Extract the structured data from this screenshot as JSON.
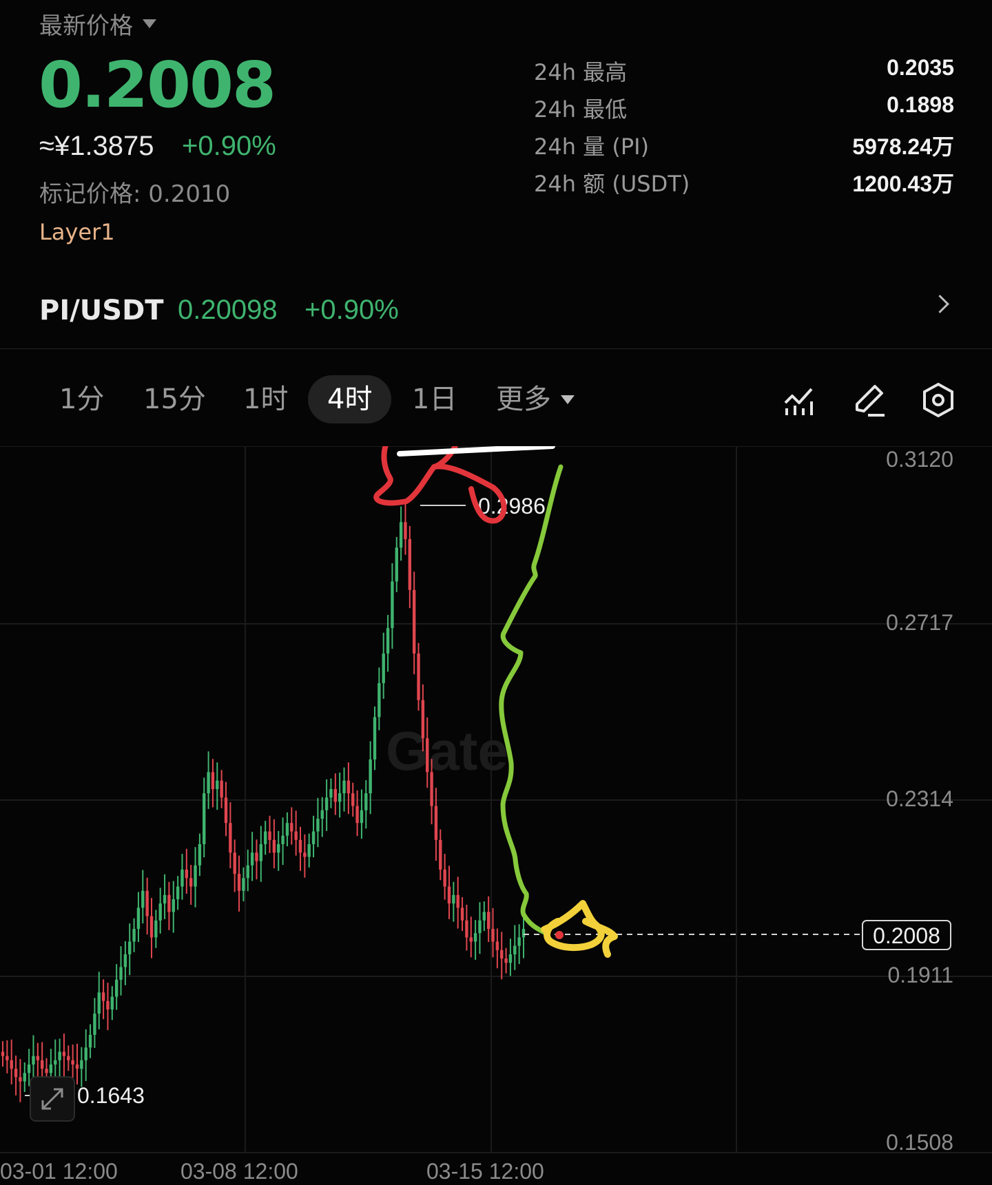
{
  "header": {
    "latest_price_label": "最新价格",
    "last_price": "0.2008",
    "cny_price": "≈¥1.3875",
    "change_pct": "+0.90%",
    "mark_price": "标记价格: 0.2010",
    "category_tag": "Layer1"
  },
  "stats": [
    {
      "label": "24h  最高",
      "value": "0.2035"
    },
    {
      "label": "24h  最低",
      "value": "0.1898"
    },
    {
      "label": "24h  量 (PI)",
      "value": "5978.24万"
    },
    {
      "label": "24h  额 (USDT)",
      "value": "1200.43万"
    }
  ],
  "pair": {
    "symbol": "PI/USDT",
    "price": "0.20098",
    "change": "+0.90%"
  },
  "tabs": [
    "1分",
    "15分",
    "1时",
    "4时",
    "1日",
    "更多"
  ],
  "active_tab": "4时",
  "toolbar_icons": [
    "indicator-icon",
    "draw-pen-icon",
    "settings-icon"
  ],
  "colors": {
    "up": "#3fb46f",
    "down": "#e0464f",
    "tag": "#e9b48a",
    "background": "#050505"
  },
  "chart_data": {
    "type": "candlestick",
    "y_axis_ticks": [
      "0.3120",
      "0.2717",
      "0.2314",
      "0.1911",
      "0.1508"
    ],
    "ylim": [
      0.1508,
      0.312
    ],
    "x_axis_ticks": [
      "03-01 12:00",
      "03-08 12:00",
      "03-15 12:00"
    ],
    "high_label": "0.2986",
    "low_label": "0.1643",
    "current_price_tag": "0.2008",
    "watermark": "Gate",
    "grid": true,
    "closes": [
      0.171,
      0.17,
      0.168,
      0.166,
      0.165,
      0.167,
      0.169,
      0.171,
      0.17,
      0.168,
      0.167,
      0.169,
      0.17,
      0.172,
      0.171,
      0.17,
      0.169,
      0.168,
      0.17,
      0.173,
      0.176,
      0.181,
      0.186,
      0.184,
      0.182,
      0.185,
      0.189,
      0.192,
      0.195,
      0.198,
      0.201,
      0.206,
      0.21,
      0.204,
      0.199,
      0.203,
      0.207,
      0.209,
      0.205,
      0.208,
      0.211,
      0.215,
      0.213,
      0.211,
      0.216,
      0.221,
      0.233,
      0.238,
      0.234,
      0.236,
      0.232,
      0.226,
      0.219,
      0.214,
      0.21,
      0.213,
      0.216,
      0.219,
      0.217,
      0.221,
      0.224,
      0.222,
      0.219,
      0.221,
      0.223,
      0.226,
      0.224,
      0.222,
      0.219,
      0.218,
      0.221,
      0.224,
      0.227,
      0.229,
      0.232,
      0.234,
      0.231,
      0.233,
      0.236,
      0.233,
      0.23,
      0.226,
      0.229,
      0.233,
      0.241,
      0.251,
      0.259,
      0.266,
      0.272,
      0.283,
      0.291,
      0.297,
      0.293,
      0.281,
      0.266,
      0.255,
      0.246,
      0.238,
      0.23,
      0.222,
      0.215,
      0.211,
      0.207,
      0.209,
      0.206,
      0.203,
      0.199,
      0.198,
      0.2,
      0.203,
      0.205,
      0.201,
      0.198,
      0.196,
      0.194,
      0.193,
      0.195,
      0.197,
      0.199,
      0.201
    ]
  }
}
